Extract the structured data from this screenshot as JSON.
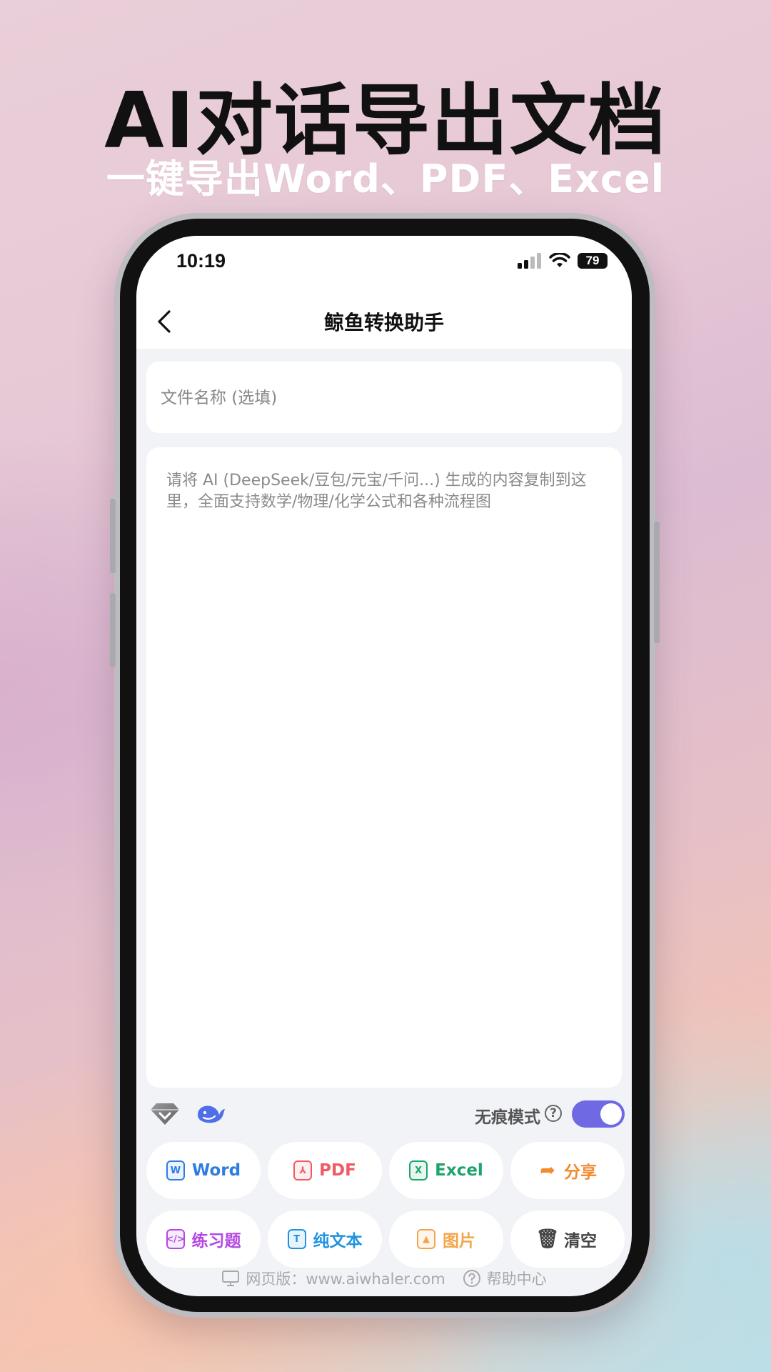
{
  "promo": {
    "headline": "AI对话导出文档",
    "subline": "一键导出Word、PDF、Excel"
  },
  "status_bar": {
    "time": "10:19",
    "battery": "79",
    "icons": [
      "signal-icon",
      "wifi-icon",
      "battery-icon"
    ]
  },
  "navbar": {
    "title": "鲸鱼转换助手",
    "back_icon": "chevron-left-icon"
  },
  "filename_field": {
    "value": "",
    "placeholder": "文件名称 (选填)"
  },
  "content_field": {
    "value": "",
    "placeholder": "请将 AI (DeepSeek/豆包/元宝/千问...) 生成的内容复制到这里，全面支持数学/物理/化学公式和各种流程图"
  },
  "toolbar": {
    "left_icons": [
      "diamond-icon",
      "whale-icon"
    ],
    "stealth_label": "无痕模式",
    "stealth_enabled": true
  },
  "actions": [
    {
      "label": "Word",
      "icon": "word-icon",
      "glyph": "W",
      "color": "#2f7de1"
    },
    {
      "label": "PDF",
      "icon": "pdf-icon",
      "glyph": "⅄",
      "color": "#f05a64"
    },
    {
      "label": "Excel",
      "icon": "excel-icon",
      "glyph": "X",
      "color": "#1ea36b"
    },
    {
      "label": "分享",
      "icon": "share-icon",
      "glyph": "➦",
      "color": "#f28a2e"
    },
    {
      "label": "练习题",
      "icon": "code-doc-icon",
      "glyph": "</>",
      "color": "#b448e4"
    },
    {
      "label": "纯文本",
      "icon": "text-icon",
      "glyph": "T",
      "color": "#1f93e0"
    },
    {
      "label": "图片",
      "icon": "image-icon",
      "glyph": "▲",
      "color": "#f4a54a"
    },
    {
      "label": "清空",
      "icon": "trash-icon",
      "glyph": "🗑",
      "color": "#444444"
    }
  ],
  "footer": {
    "web_label": "网页版：www.aiwhaler.com",
    "help_label": "帮助中心"
  }
}
